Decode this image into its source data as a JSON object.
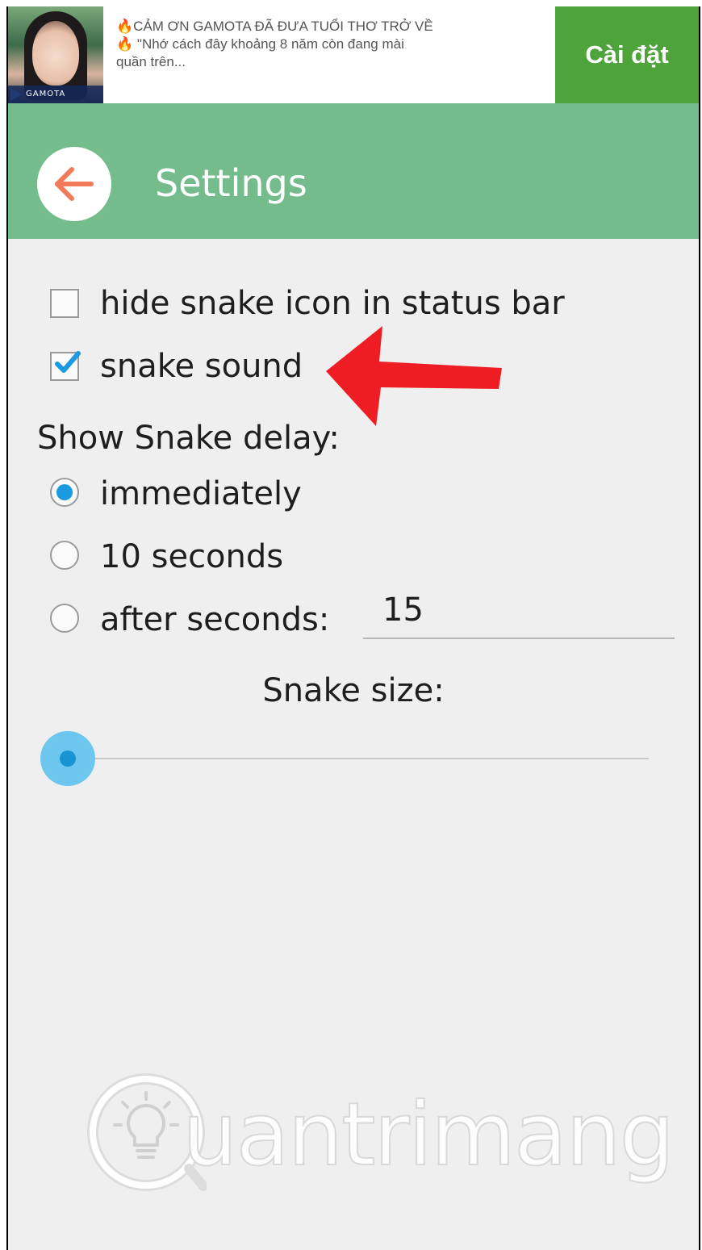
{
  "ad": {
    "line1": "CẢM ƠN GAMOTA ĐÃ ĐƯA TUỔI THƠ TRỞ VỀ",
    "line2": "\"Nhớ cách đây khoảng 8 năm còn đang mài",
    "line3": "quần trên...",
    "brand": "GAMOTA",
    "install_label": "Cài đặt",
    "fire_icon": "🔥"
  },
  "toolbar": {
    "title": "Settings",
    "back_icon": "back-arrow-icon",
    "color": "#74bc8b"
  },
  "options": {
    "hide_icon_label": "hide snake icon in status bar",
    "hide_icon_checked": false,
    "sound_label": "snake sound",
    "sound_checked": true
  },
  "delay": {
    "title": "Show Snake delay:",
    "options": [
      {
        "label": "immediately",
        "selected": true
      },
      {
        "label": "10 seconds",
        "selected": false
      },
      {
        "label": "after seconds:",
        "selected": false
      }
    ],
    "after_seconds_value": "15"
  },
  "size": {
    "title": "Snake size:",
    "slider_fraction": 0.0
  },
  "watermark": {
    "text": "uantrimang"
  }
}
